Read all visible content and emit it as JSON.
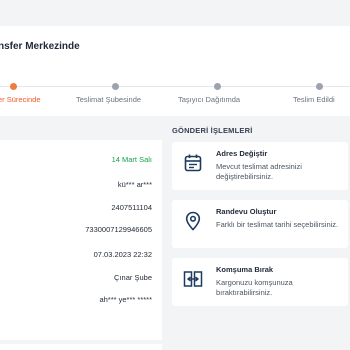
{
  "status": {
    "title": "nsfer Merkezinde",
    "steps": [
      {
        "label": "er Sürecinde",
        "active": true
      },
      {
        "label": "Teslimat Şubesinde",
        "active": false
      },
      {
        "label": "Taşıyıcı Dağıtımda",
        "active": false
      },
      {
        "label": "Teslim Edildi",
        "active": false
      }
    ]
  },
  "shipment": {
    "values": [
      "14 Mart Salı",
      "kü*** ar***",
      "2407511104",
      "7330007129946605",
      "07.03.2023 22:32",
      "Çınar Şube",
      "ah*** ye*** *****"
    ]
  },
  "operations": {
    "title": "GÖNDERİ İŞLEMLERİ",
    "items": [
      {
        "icon": "calendar-icon",
        "title": "Adres Değiştir",
        "desc": "Mevcut teslimat adresinizi değiştirebilirsiniz."
      },
      {
        "icon": "location-pin-icon",
        "title": "Randevu Oluştur",
        "desc": "Farklı bir teslimat tarihi seçebilirsiniz."
      },
      {
        "icon": "neighbor-delivery-icon",
        "title": "Komşuma Bırak",
        "desc": "Kargonuzu komşunuza bıraktırabilirsiniz."
      }
    ]
  },
  "colors": {
    "accent": "#ef5a2a",
    "green": "#16a34a",
    "icon": "#1e3a5f"
  }
}
